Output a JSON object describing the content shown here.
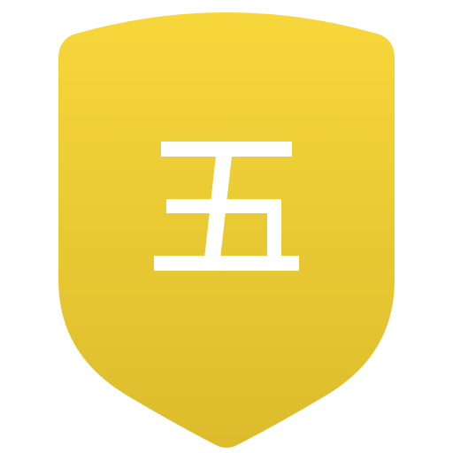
{
  "badge": {
    "glyph_name": "five-kanji",
    "glyph_char": "五",
    "colors": {
      "shield_top": "#f7d73a",
      "shield_bottom": "#dcbc2c",
      "glyph": "#ffffff"
    }
  }
}
